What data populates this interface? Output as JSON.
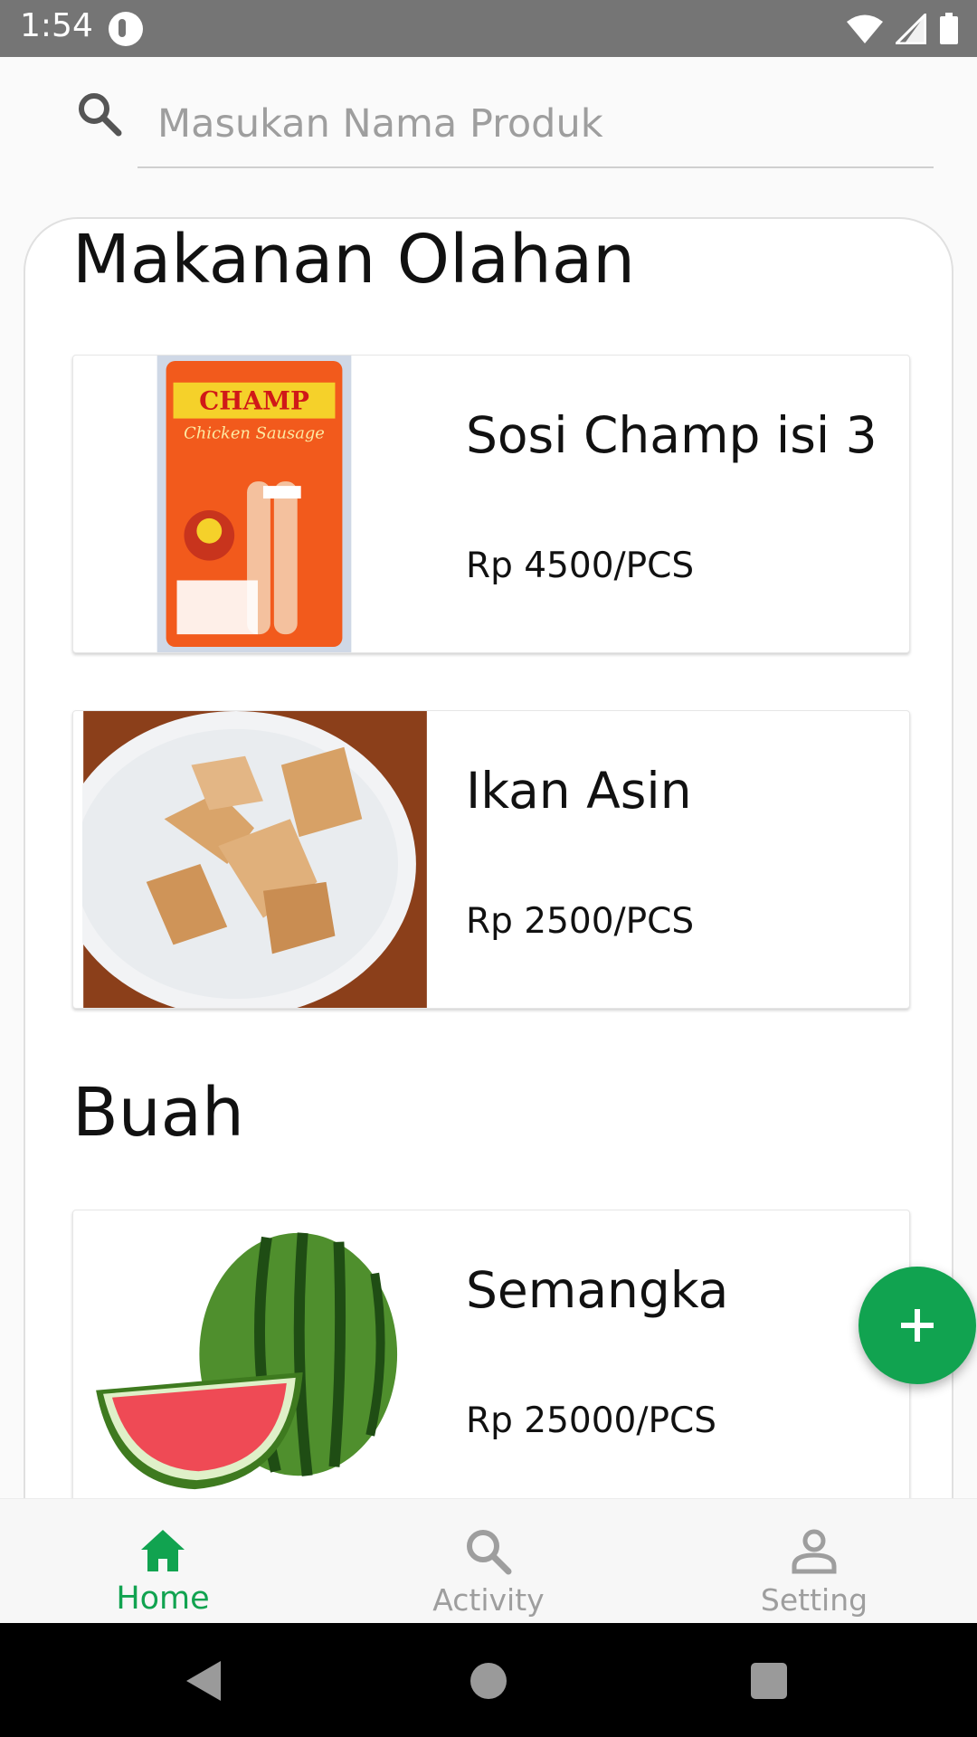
{
  "status_bar": {
    "time": "1:54",
    "icons": [
      "app-notification-icon",
      "wifi-icon",
      "cellular-signal-icon",
      "battery-icon"
    ]
  },
  "search": {
    "placeholder": "Masukan Nama Produk",
    "value": ""
  },
  "categories": [
    {
      "title": "Makanan Olahan",
      "products": [
        {
          "name": "Sosi Champ isi 3",
          "price": "Rp 4500/PCS",
          "image": "sausage-pack-image"
        },
        {
          "name": "Ikan Asin",
          "price": "Rp 2500/PCS",
          "image": "dried-fish-image"
        }
      ]
    },
    {
      "title": "Buah",
      "products": [
        {
          "name": "Semangka",
          "price": "Rp 25000/PCS",
          "image": "watermelon-image"
        }
      ]
    }
  ],
  "fab": {
    "icon": "plus-icon",
    "color": "#11a350"
  },
  "bottom_nav": {
    "items": [
      {
        "label": "Home",
        "icon": "home-icon",
        "active": true
      },
      {
        "label": "Activity",
        "icon": "search-icon",
        "active": false
      },
      {
        "label": "Setting",
        "icon": "person-icon",
        "active": false
      }
    ]
  },
  "system_nav": [
    "back-icon",
    "home-circle-icon",
    "recents-icon"
  ],
  "colors": {
    "accent": "#11a350",
    "status_bar": "#757575",
    "inactive": "#9e9e9e"
  }
}
